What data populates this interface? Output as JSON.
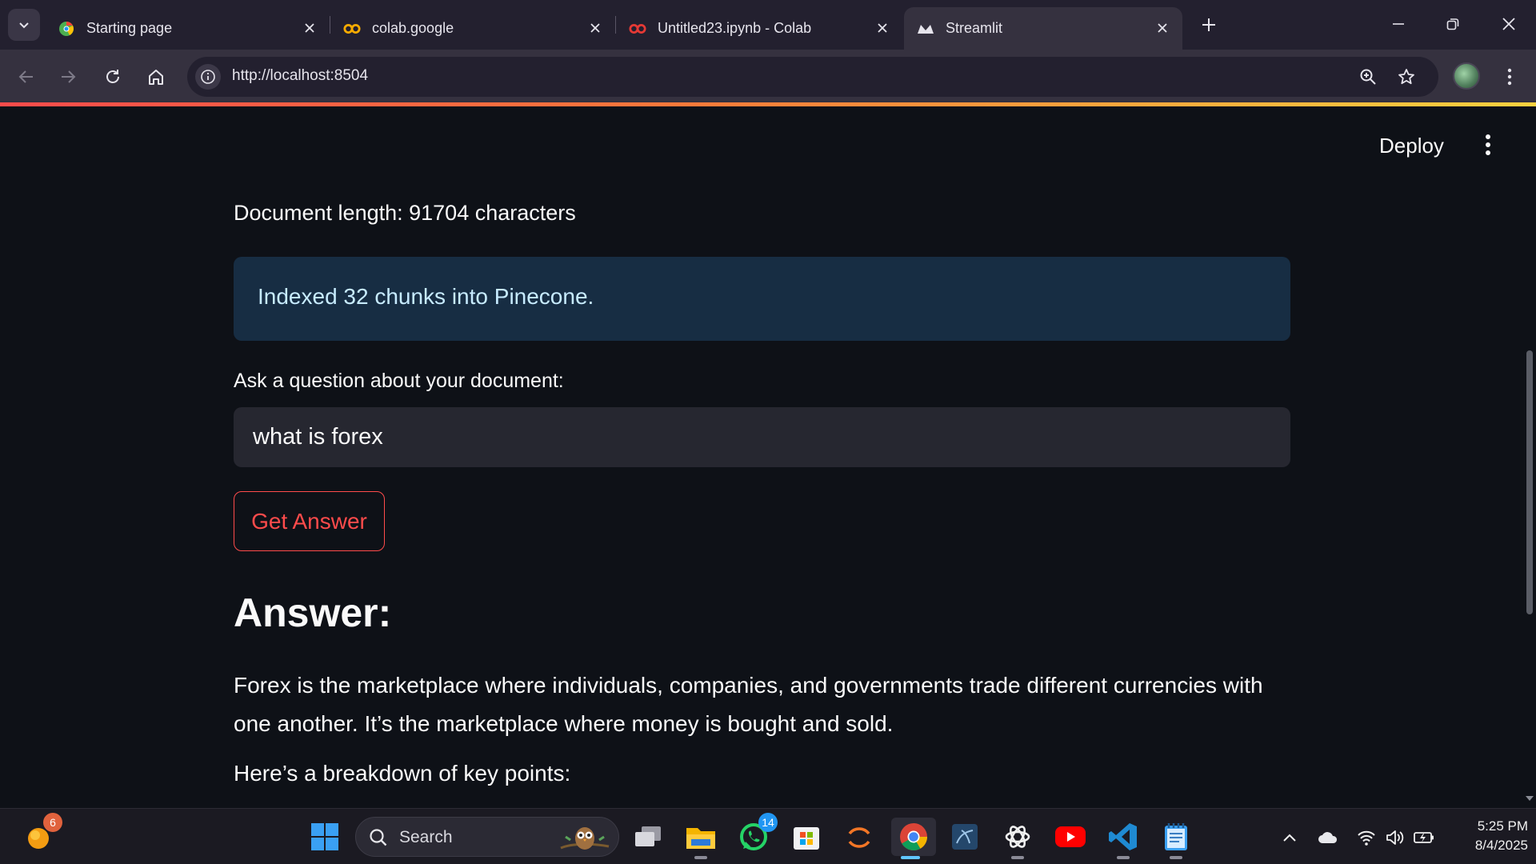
{
  "browser": {
    "tabs": [
      {
        "title": "Starting page",
        "icon": "opera-icon"
      },
      {
        "title": "colab.google",
        "icon": "colab-icon"
      },
      {
        "title": "Untitled23.ipynb - Colab",
        "icon": "colab-icon"
      },
      {
        "title": "Streamlit",
        "icon": "streamlit-icon",
        "active": true
      }
    ],
    "url": "http://localhost:8504"
  },
  "app": {
    "deploy_label": "Deploy",
    "doc_length": "Document length: 91704 characters",
    "info_message": "Indexed 32 chunks into Pinecone.",
    "question_label": "Ask a question about your document:",
    "question_value": "what is forex",
    "button_label": "Get Answer",
    "answer_heading": "Answer:",
    "answer_paragraph": "Forex is the marketplace where individuals, companies, and governments trade different currencies with one another. It’s the marketplace where money is bought and sold.",
    "answer_followup": "Here’s a breakdown of key points:"
  },
  "taskbar": {
    "search_placeholder": "Search",
    "widget_badge": "6",
    "whatsapp_badge": "14",
    "time": "5:25 PM",
    "date": "8/4/2025"
  },
  "colors": {
    "accent": "#ff4b4b",
    "info_bg": "#172d43",
    "page_bg": "#0e1117"
  }
}
